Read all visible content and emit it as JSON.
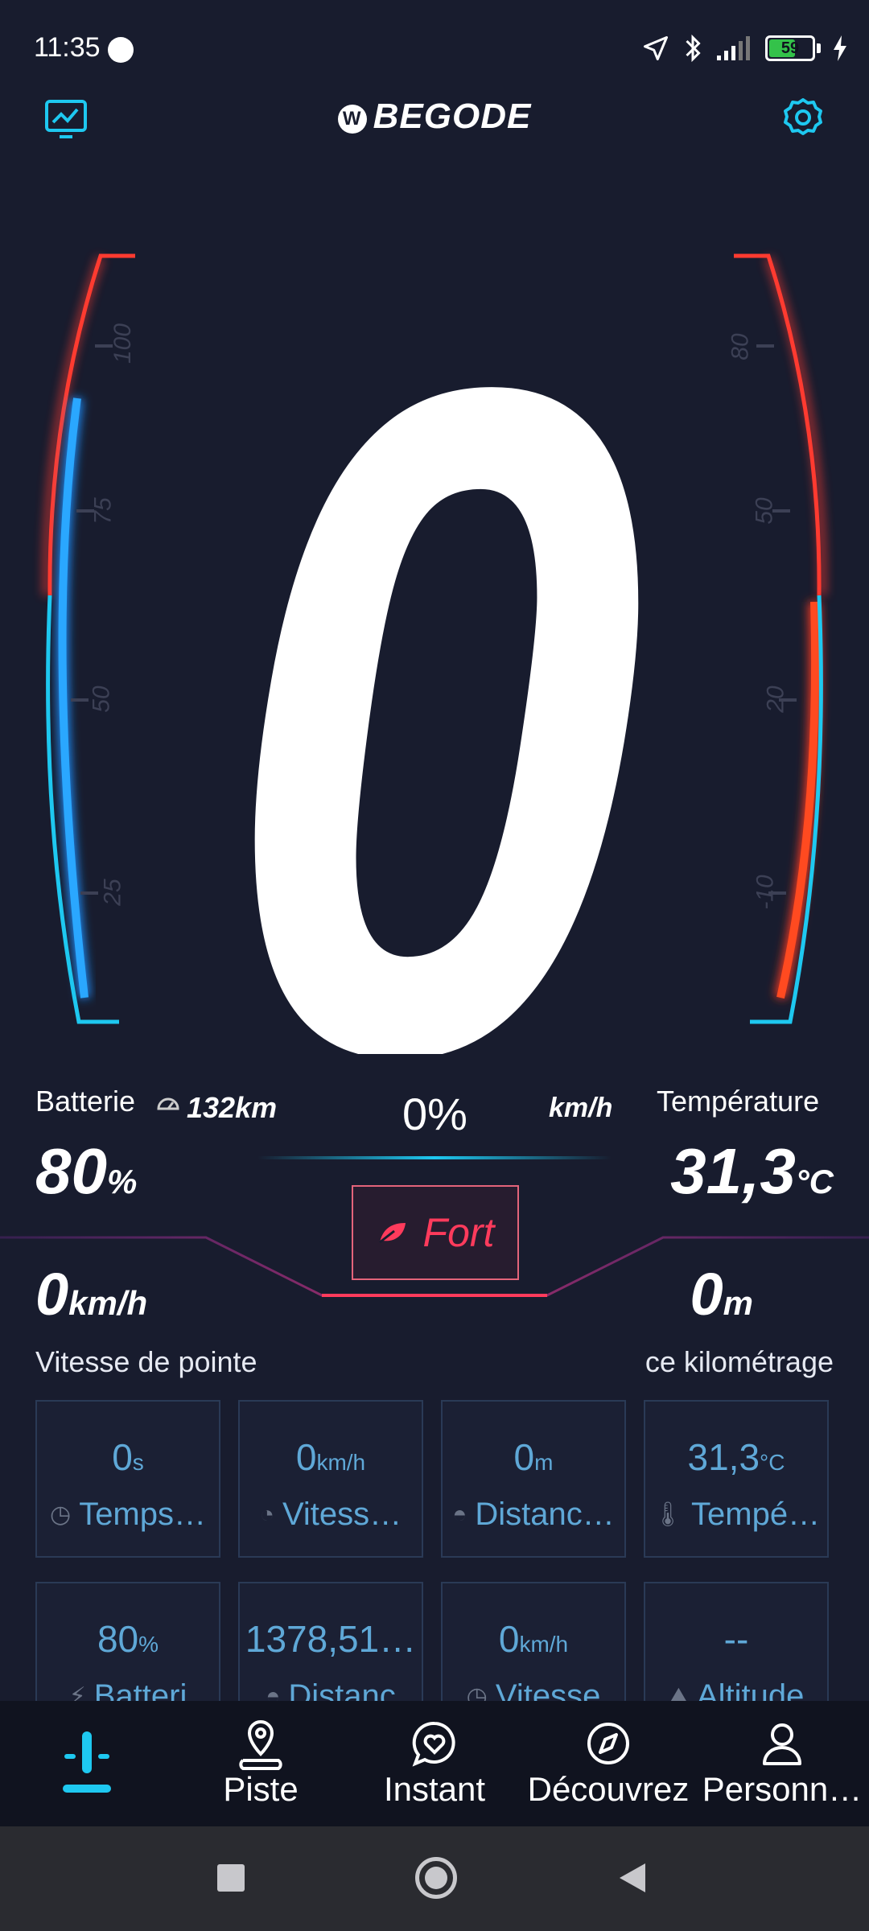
{
  "status_bar": {
    "time": "11:35",
    "battery_level": "59"
  },
  "header": {
    "brand": "BEGODE"
  },
  "speed_display": {
    "value": "0"
  },
  "gauge_left": {
    "ticks": [
      "100",
      "75",
      "50",
      "25"
    ]
  },
  "gauge_right": {
    "ticks": [
      "80",
      "50",
      "20",
      "-10"
    ]
  },
  "battery": {
    "label": "Batterie",
    "value": "80",
    "unit": "%",
    "range": "132km"
  },
  "center": {
    "percent": "0%",
    "speed_unit": "km/h"
  },
  "temperature": {
    "label": "Température",
    "value": "31,3",
    "unit": "°C"
  },
  "mode": {
    "label": "Fort"
  },
  "top_speed": {
    "value": "0",
    "unit": "km/h",
    "label": "Vitesse de pointe"
  },
  "trip_distance": {
    "value": "0",
    "unit": "m",
    "label": "ce kilométrage"
  },
  "tiles": [
    {
      "value": "0",
      "unit": "s",
      "name": "Temps…"
    },
    {
      "value": "0",
      "unit": "km/h",
      "name": "Vitess…"
    },
    {
      "value": "0",
      "unit": "m",
      "name": "Distanc…"
    },
    {
      "value": "31,3",
      "unit": "°C",
      "name": "Tempé…"
    },
    {
      "value": "80",
      "unit": "%",
      "name": "Batteri"
    },
    {
      "value": "1378,51…",
      "unit": "",
      "name": "Distanc"
    },
    {
      "value": "0",
      "unit": "km/h",
      "name": "Vitesse"
    },
    {
      "value": "--",
      "unit": "",
      "name": "Altitude"
    }
  ],
  "nav": [
    {
      "label": ""
    },
    {
      "label": "Piste"
    },
    {
      "label": "Instant"
    },
    {
      "label": "Découvrez"
    },
    {
      "label": "Personn…"
    }
  ],
  "colors": {
    "background": "#181c2e",
    "accent_blue": "#1ec8f0",
    "accent_red": "#ff3b30",
    "tile_text": "#5fa8d7"
  }
}
